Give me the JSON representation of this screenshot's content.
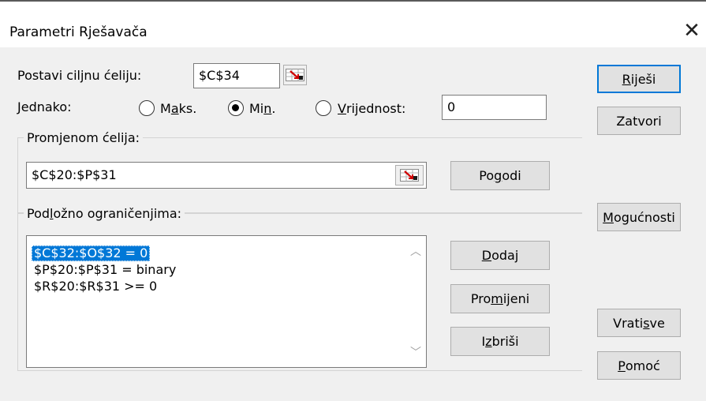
{
  "dialog": {
    "title": "Parametri Rješavača"
  },
  "target": {
    "label": "Postavi ciljnu ćeliju:",
    "value": "$C$34"
  },
  "equal": {
    "label": "Jednako:",
    "options": [
      {
        "pre": "M",
        "key": "a",
        "post": "ks.",
        "selected": false
      },
      {
        "pre": "Mi",
        "key": "n",
        "post": ".",
        "selected": true
      },
      {
        "pre": "",
        "key": "V",
        "post": "rijednost:",
        "selected": false
      }
    ],
    "value": "0"
  },
  "changing": {
    "label_pre": "Prom",
    "label_key": "j",
    "label_post": "enom ćelija:",
    "value": "$C$20:$P$31",
    "guess_pre": "Po",
    "guess_key": "g",
    "guess_post": "odi"
  },
  "constraints": {
    "label_pre": "Pod",
    "label_key": "l",
    "label_post": "ožno ograničenjima:",
    "items": [
      "$C$32:$O$32 = 0",
      "$P$20:$P$31 = binary",
      "$R$20:$R$31 >= 0"
    ],
    "add_pre": "",
    "add_key": "D",
    "add_post": "odaj",
    "change_pre": "Pro",
    "change_key": "m",
    "change_post": "ijeni",
    "delete_pre": "I",
    "delete_key": "z",
    "delete_post": "briši"
  },
  "side": {
    "solve_pre": "",
    "solve_key": "R",
    "solve_post": "iješi",
    "close": "Zatvori",
    "options_pre": "",
    "options_key": "M",
    "options_post": "ogućnosti",
    "reset_pre": "Vrati ",
    "reset_key": "s",
    "reset_post": "ve",
    "help_pre": "",
    "help_key": "P",
    "help_post": "omoć"
  }
}
